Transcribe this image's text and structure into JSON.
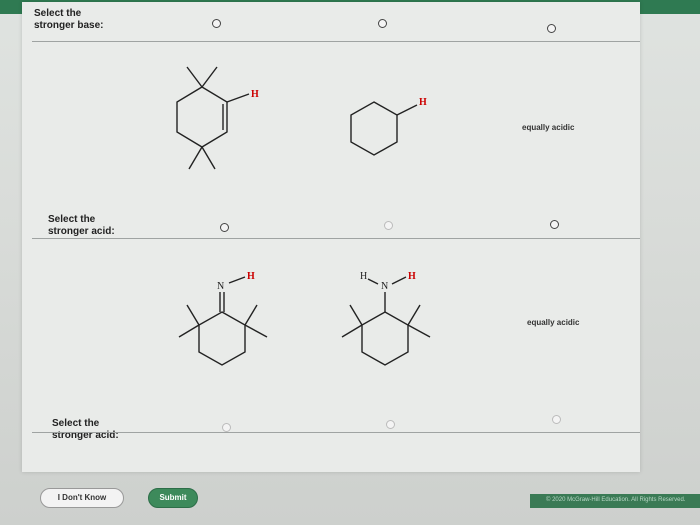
{
  "questions": [
    {
      "label": "Select the\nstronger base:"
    },
    {
      "label": "Select the\nstronger acid:"
    },
    {
      "label": "Select the\nstronger acid:"
    }
  ],
  "choices": {
    "equal_base_row": "equally acidic",
    "equal_acid_row": "equally acidic"
  },
  "molecules": {
    "h": "H",
    "n": "N"
  },
  "buttons": {
    "dont_know": "I Don't Know",
    "submit": "Submit"
  },
  "footer": {
    "copyright": "© 2020 McGraw-Hill Education. All Rights Reserved."
  },
  "colors": {
    "submit_green": "#3d8a5b",
    "header_green": "#2f7a52"
  }
}
